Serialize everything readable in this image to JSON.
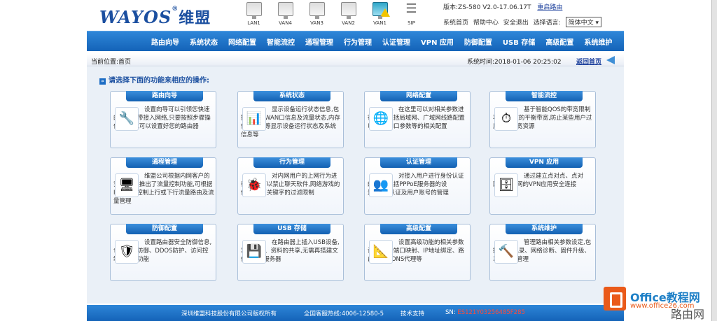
{
  "header": {
    "logo_text": "WAYOS",
    "logo_reg": "®",
    "logo_cn": "维盟",
    "version": "版本:ZS-580 V2.0-17.06.17T",
    "reboot": "重启路由",
    "links": [
      "系统首页",
      "帮助中心",
      "安全退出"
    ],
    "lang_label": "选择语言:",
    "lang_value": "简体中文"
  },
  "ports": [
    {
      "label": "LAN1",
      "active": false
    },
    {
      "label": "VAN4",
      "active": false
    },
    {
      "label": "VAN3",
      "active": false
    },
    {
      "label": "VAN2",
      "active": false
    },
    {
      "label": "VAN1",
      "active": true
    },
    {
      "label": "SIP",
      "active": false
    }
  ],
  "nav": [
    "路由向导",
    "系统状态",
    "网络配置",
    "智能流控",
    "通程管理",
    "行为管理",
    "认证管理",
    "VPN 应用",
    "防御配置",
    "USB 存储",
    "高级配置",
    "系统维护"
  ],
  "subbar": {
    "crumb": "当前位置:首页",
    "time": "系统时间:2018-01-06 20:25:02",
    "back": "返回首页"
  },
  "instruction": "请选择下面的功能来相应的操作:",
  "cards": [
    {
      "title": "路由向导",
      "icon": "tools-icon",
      "glyph": "🔧",
      "desc": "设置向导可以引领您快速的完成宽带接入网络,只要按照步骤操作完成,就可以设置好您的路由器"
    },
    {
      "title": "系统状态",
      "icon": "status-chart-icon",
      "glyph": "📊",
      "desc": "显示设备运行状态信息,包括LAN、WAN口信息及流量状态,内存使用情况等显示设备运行状态及系统信息等"
    },
    {
      "title": "网络配置",
      "icon": "globe-icon",
      "glyph": "🌐",
      "desc": "在这里可以对相关参数进行设置,包括局域网、广域网线路配置以及WAN口参数等的相关配置"
    },
    {
      "title": "智能流控",
      "icon": "gauge-icon",
      "glyph": "⏱",
      "desc": "基于智能QOS的带宽限制功能,有效的平衡带宽,防止某些用户过度占用带宽资源"
    },
    {
      "title": "通程管理",
      "icon": "monitor-icon",
      "glyph": "🖥",
      "desc": "维盟公司根据内网客户的实际需求,推出了流量控制功能,可根据IP地址等控制上行或下行流量路由及流量管理"
    },
    {
      "title": "行为管理",
      "icon": "bug-icon",
      "glyph": "🐞",
      "desc": "对内网用户的上网行为进行管控,可以禁止聊天软件,网络游戏的使用,网页关键字的过滤限制"
    },
    {
      "title": "认证管理",
      "icon": "users-icon",
      "glyph": "👥",
      "desc": "对接入用户进行身份认证的操作,包括PPPoE服务器的设置,WEB认证及用户账号的管理"
    },
    {
      "title": "VPN 应用",
      "icon": "server-icon",
      "glyph": "🗄",
      "desc": "通过建立点对点、点对网、网对网的VPN应用安全连接"
    },
    {
      "title": "防御配置",
      "icon": "shield-icon",
      "glyph": "🛡",
      "desc": "设置路由器安全防御信息,包括ARP防御、DDOS防护、访问控制等安全功能"
    },
    {
      "title": "USB 存储",
      "icon": "usb-drive-icon",
      "glyph": "💾",
      "desc": "在路由器上插入USB设备,实现文件、资料的共享,无需再搭建文件、FTP服务器"
    },
    {
      "title": "高级配置",
      "icon": "blueprint-icon",
      "glyph": "📐",
      "desc": "设置高级功能的相关参数设置,包括端口映射、IP地址绑定、路由设置、DNS代理等"
    },
    {
      "title": "系统维护",
      "icon": "wrench-icon",
      "glyph": "🔨",
      "desc": "管理路由相关参数设定,包括:日志记录、网络诊断、固件升级、系统参数管理"
    }
  ],
  "footer": {
    "copy": "深圳维盟科技股份有限公司版权所有",
    "hotline": "全国客服热线:4006-12580-5",
    "support": "技术支持",
    "sn_label": "SN:",
    "sn_value": "ES121Y03256485F285"
  },
  "watermark": {
    "title": "Office教程网",
    "url": "www.office26.com",
    "brand2": "路由网"
  },
  "colors": {
    "nav_blue": "#1463b8",
    "card_head": "#1260b2",
    "sn_red": "#ff4a3a",
    "wm_orange": "#ea5a1a"
  }
}
